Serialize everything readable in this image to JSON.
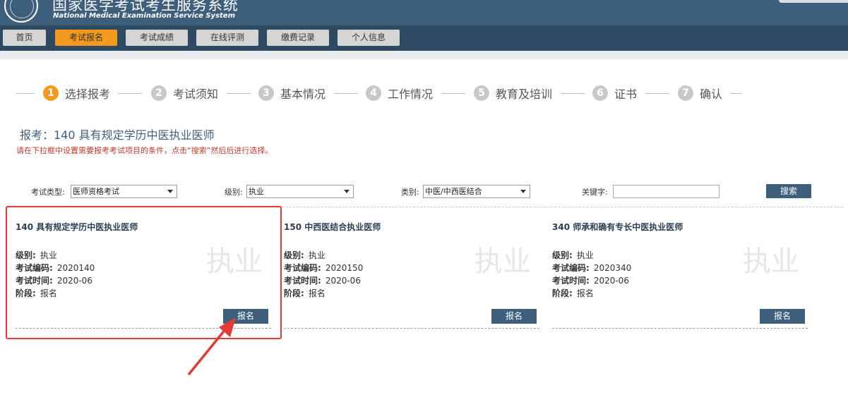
{
  "header": {
    "title_cn": "国家医学考试考生服务系统",
    "title_en": "National Medical Examination Service System"
  },
  "nav": [
    {
      "label": "首页",
      "active": false
    },
    {
      "label": "考试报名",
      "active": true
    },
    {
      "label": "考试成绩",
      "active": false
    },
    {
      "label": "在线评测",
      "active": false
    },
    {
      "label": "缴费记录",
      "active": false
    },
    {
      "label": "个人信息",
      "active": false
    }
  ],
  "steps": [
    {
      "num": "1",
      "label": "选择报考",
      "active": true
    },
    {
      "num": "2",
      "label": "考试须知",
      "active": false
    },
    {
      "num": "3",
      "label": "基本情况",
      "active": false
    },
    {
      "num": "4",
      "label": "工作情况",
      "active": false
    },
    {
      "num": "5",
      "label": "教育及培训",
      "active": false
    },
    {
      "num": "6",
      "label": "证书",
      "active": false
    },
    {
      "num": "7",
      "label": "确认",
      "active": false
    }
  ],
  "page": {
    "heading": "报考：140 具有规定学历中医执业医师",
    "hint": "请在下拉框中设置需要报考考试项目的条件，点击“搜索”然后后进行选择。"
  },
  "filters": {
    "exam_type_label": "考试类型:",
    "exam_type_value": "医师资格考试",
    "level_label": "级别:",
    "level_value": "执业",
    "category_label": "类别:",
    "category_value": "中医/中西医结合",
    "keyword_label": "关键字:",
    "keyword_value": "",
    "search_label": "搜索"
  },
  "card_fields": {
    "level": "级别:",
    "code": "考试编码:",
    "time": "考试时间:",
    "stage": "阶段:"
  },
  "cards": [
    {
      "title": "140 具有规定学历中医执业医师",
      "watermark": "执业",
      "level": "执业",
      "code": "2020140",
      "time": "2020-06",
      "stage": "报名",
      "button": "报名"
    },
    {
      "title": "150 中西医结合执业医师",
      "watermark": "执业",
      "level": "执业",
      "code": "2020150",
      "time": "2020-06",
      "stage": "报名",
      "button": "报名"
    },
    {
      "title": "340 师承和确有专长中医执业医师",
      "watermark": "执业",
      "level": "执业",
      "code": "2020340",
      "time": "2020-06",
      "stage": "报名",
      "button": "报名"
    }
  ],
  "colors": {
    "primary": "#3e5f7c",
    "nav_bg": "#2e4a63",
    "accent": "#f39a1d",
    "annotation": "#e53935"
  }
}
